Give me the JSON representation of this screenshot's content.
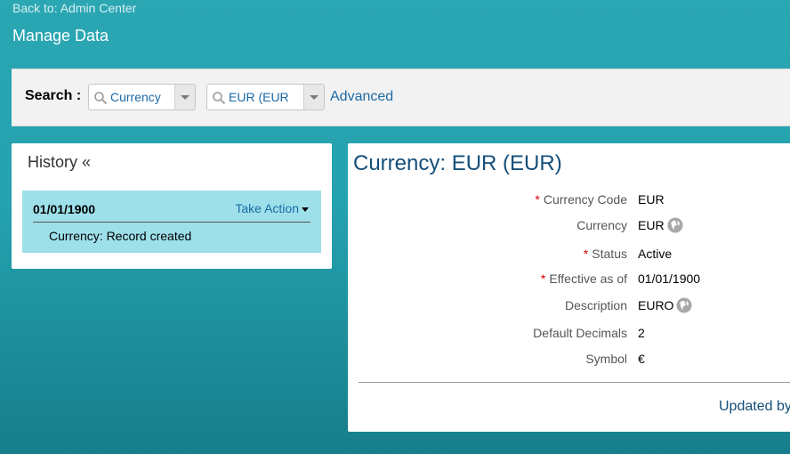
{
  "header": {
    "back_link": "Back to: Admin Center",
    "page_title": "Manage Data"
  },
  "search": {
    "label": "Search :",
    "type_value": "Currency",
    "record_value": "EUR (EUR",
    "advanced_link": "Advanced"
  },
  "history": {
    "title": "History",
    "collapse_glyph": "«",
    "entries": [
      {
        "date": "01/01/1900",
        "action_label": "Take Action",
        "description": "Currency: Record created"
      }
    ]
  },
  "details": {
    "title": "Currency: EUR (EUR)",
    "required_marker": "*",
    "fields": [
      {
        "label": "Currency Code",
        "value": "EUR",
        "required": true
      },
      {
        "label": "Currency",
        "value": "EUR",
        "required": false,
        "icon": "globe-icon"
      },
      {
        "label": "Status",
        "value": "Active",
        "required": true
      },
      {
        "label": "Effective as of",
        "value": "01/01/1900",
        "required": true
      },
      {
        "label": "Description",
        "value": "EURO",
        "required": false,
        "icon": "globe-icon"
      },
      {
        "label": "Default Decimals",
        "value": "2",
        "required": false
      },
      {
        "label": "Symbol",
        "value": "€",
        "required": false
      }
    ],
    "updated_by_label": "Updated by"
  },
  "colors": {
    "background_teal": "#25a2af",
    "link_blue": "#1b6aa6",
    "title_blue": "#154f7a",
    "history_entry_bg": "#9ee0ea",
    "required_red": "#d40000"
  }
}
